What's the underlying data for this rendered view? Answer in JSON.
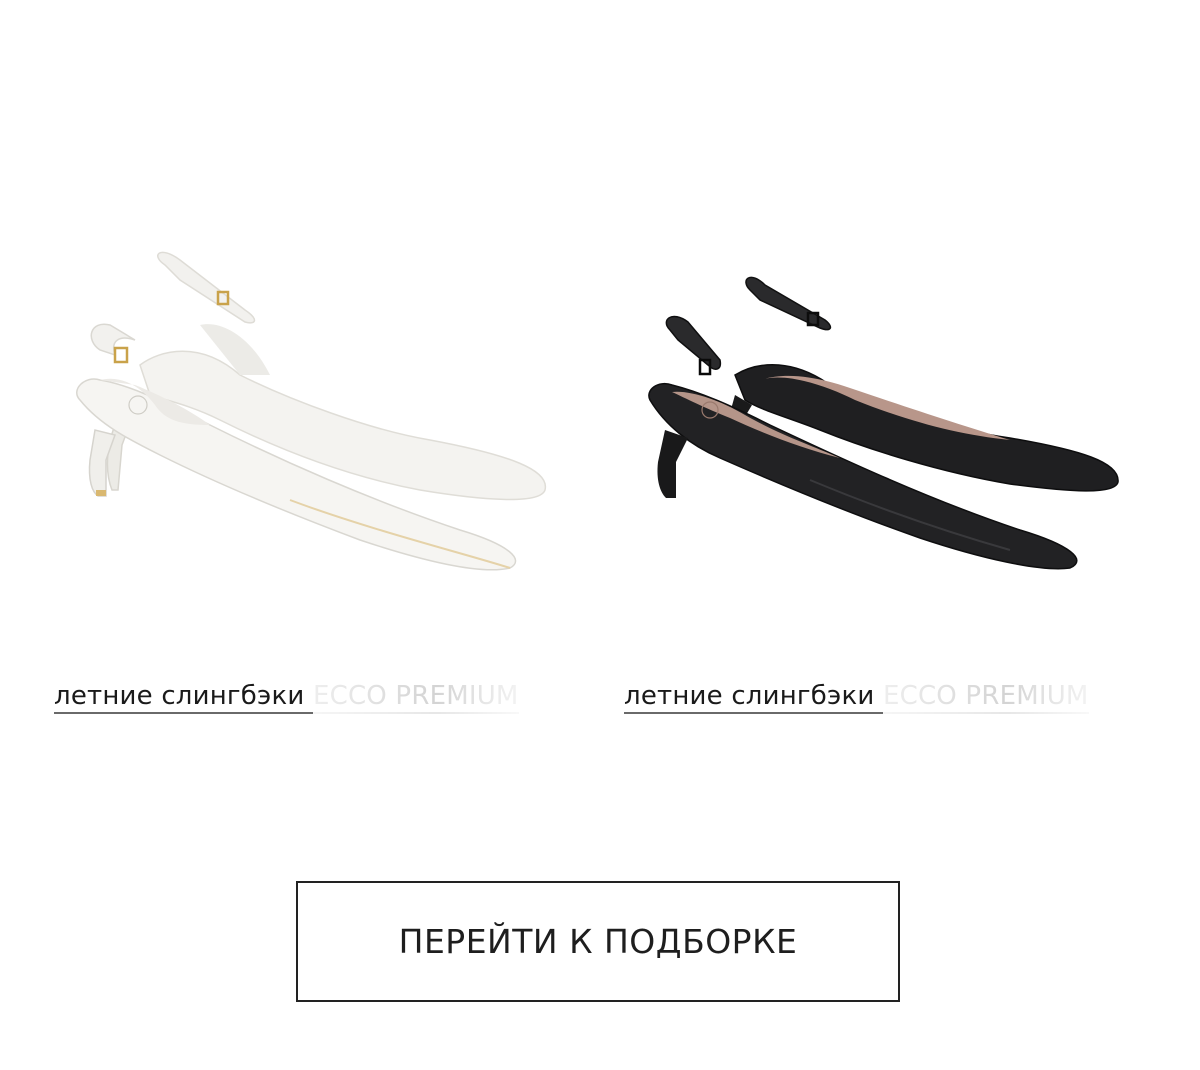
{
  "products": [
    {
      "title_main": "летние слингбэки ",
      "title_faded": "ECCO PREMIUM",
      "shoe_color": "white"
    },
    {
      "title_main": "летние слингбэки ",
      "title_faded": "ECCO PREMIUM",
      "shoe_color": "black"
    }
  ],
  "cta": {
    "label": "ПЕРЕЙТИ К ПОДБОРКЕ"
  },
  "colors": {
    "background": "#ffffff",
    "text": "#1a1a1a",
    "border": "#222222"
  }
}
